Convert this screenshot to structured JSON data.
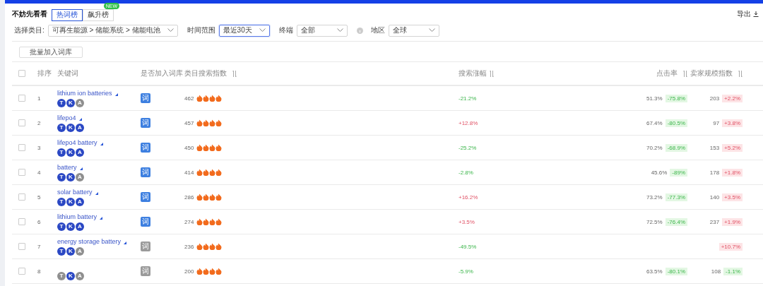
{
  "header": {
    "title": "不妨先看看",
    "tabs": [
      {
        "label": "热词榜",
        "selected": true
      },
      {
        "label": "飙升榜",
        "selected": false,
        "badge": "NEW"
      }
    ],
    "export": "导出"
  },
  "filters": [
    {
      "label": "选择类目:",
      "value": "可再生能源 > 储能系统 > 储能电池",
      "focused": false
    },
    {
      "label": "时间范围",
      "value": "最近30天",
      "focused": true
    },
    {
      "label": "终端",
      "value": "全部",
      "focused": false,
      "info": true
    },
    {
      "label": "地区",
      "value": "全球",
      "focused": false
    }
  ],
  "bulk_button": "批量加入词库",
  "table": {
    "all_checked": false,
    "columns": [
      {
        "label": "排序",
        "sortable": false
      },
      {
        "label": "关键词",
        "sortable": false
      },
      {
        "label": "是否加入词库",
        "sortable": false
      },
      {
        "label": "类目搜索指数",
        "sortable": true
      },
      {
        "label": "搜索涨幅",
        "sortable": true
      },
      {
        "label": "点击率",
        "sortable": true
      },
      {
        "label": "卖家规模指数",
        "sortable": true
      }
    ],
    "rows": [
      {
        "checked": false,
        "rank": "1",
        "keyword": "lithium ion batteries",
        "tags": [
          {
            "label": "T",
            "on": true
          },
          {
            "label": "K",
            "on": true
          },
          {
            "label": "A",
            "on": false
          }
        ],
        "in_library": true,
        "library_label": "词",
        "search_index": "462",
        "stars": 4,
        "growth": "-21.2%",
        "growth_rising": false,
        "click_rate": "51.3%",
        "click_change": "-75.8%",
        "click_rising": false,
        "sellers": "203",
        "sellers_change": "+2.2%",
        "sellers_rising": true
      },
      {
        "checked": false,
        "rank": "2",
        "keyword": "lifepo4",
        "tags": [
          {
            "label": "T",
            "on": true
          },
          {
            "label": "K",
            "on": true
          },
          {
            "label": "A",
            "on": true
          }
        ],
        "in_library": true,
        "library_label": "词",
        "search_index": "457",
        "stars": 4,
        "growth": "+12.8%",
        "growth_rising": true,
        "click_rate": "67.4%",
        "click_change": "-80.5%",
        "click_rising": false,
        "sellers": "97",
        "sellers_change": "+3.8%",
        "sellers_rising": true
      },
      {
        "checked": false,
        "rank": "3",
        "keyword": "lifepo4 battery",
        "tags": [
          {
            "label": "T",
            "on": true
          },
          {
            "label": "K",
            "on": true
          },
          {
            "label": "A",
            "on": true
          }
        ],
        "in_library": true,
        "library_label": "词",
        "search_index": "450",
        "stars": 4,
        "growth": "-25.2%",
        "growth_rising": false,
        "click_rate": "70.2%",
        "click_change": "-68.9%",
        "click_rising": false,
        "sellers": "153",
        "sellers_change": "+5.2%",
        "sellers_rising": true
      },
      {
        "checked": false,
        "rank": "4",
        "keyword": "battery",
        "tags": [
          {
            "label": "T",
            "on": true
          },
          {
            "label": "K",
            "on": true
          },
          {
            "label": "A",
            "on": false
          }
        ],
        "in_library": true,
        "library_label": "词",
        "search_index": "414",
        "stars": 4,
        "growth": "-2.8%",
        "growth_rising": false,
        "click_rate": "45.6%",
        "click_change": "-89%",
        "click_rising": false,
        "sellers": "178",
        "sellers_change": "+1.8%",
        "sellers_rising": true
      },
      {
        "checked": false,
        "rank": "5",
        "keyword": "solar battery",
        "tags": [
          {
            "label": "T",
            "on": true
          },
          {
            "label": "K",
            "on": true
          },
          {
            "label": "A",
            "on": true
          }
        ],
        "in_library": true,
        "library_label": "词",
        "search_index": "286",
        "stars": 4,
        "growth": "+16.2%",
        "growth_rising": true,
        "click_rate": "73.2%",
        "click_change": "-77.3%",
        "click_rising": false,
        "sellers": "140",
        "sellers_change": "+3.5%",
        "sellers_rising": true
      },
      {
        "checked": false,
        "rank": "6",
        "keyword": "lithium battery",
        "tags": [
          {
            "label": "T",
            "on": true
          },
          {
            "label": "K",
            "on": true
          },
          {
            "label": "A",
            "on": true
          }
        ],
        "in_library": true,
        "library_label": "词",
        "search_index": "274",
        "stars": 4,
        "growth": "+3.5%",
        "growth_rising": true,
        "click_rate": "72.5%",
        "click_change": "-76.4%",
        "click_rising": false,
        "sellers": "237",
        "sellers_change": "+1.9%",
        "sellers_rising": true
      },
      {
        "checked": false,
        "rank": "7",
        "keyword": "energy storage battery",
        "tags": [
          {
            "label": "T",
            "on": true
          },
          {
            "label": "K",
            "on": true
          },
          {
            "label": "A",
            "on": false
          }
        ],
        "in_library": false,
        "library_label": "词",
        "search_index": "236",
        "stars": 4,
        "growth": "-49.5%",
        "growth_rising": false,
        "sellers_change": "+10.7%",
        "sellers_rising": true
      },
      {
        "checked": false,
        "rank": "8",
        "tags": [
          {
            "label": "T",
            "on": false
          },
          {
            "label": "K",
            "on": true
          },
          {
            "label": "A",
            "on": false
          }
        ],
        "in_library": false,
        "library_label": "词",
        "search_index": "200",
        "stars": 4,
        "growth": "-5.9%",
        "growth_rising": false,
        "click_rate": "63.5%",
        "click_change": "-80.1%",
        "click_rising": false,
        "sellers": "108",
        "sellers_change": "-1.1%",
        "sellers_rising": false
      }
    ]
  }
}
